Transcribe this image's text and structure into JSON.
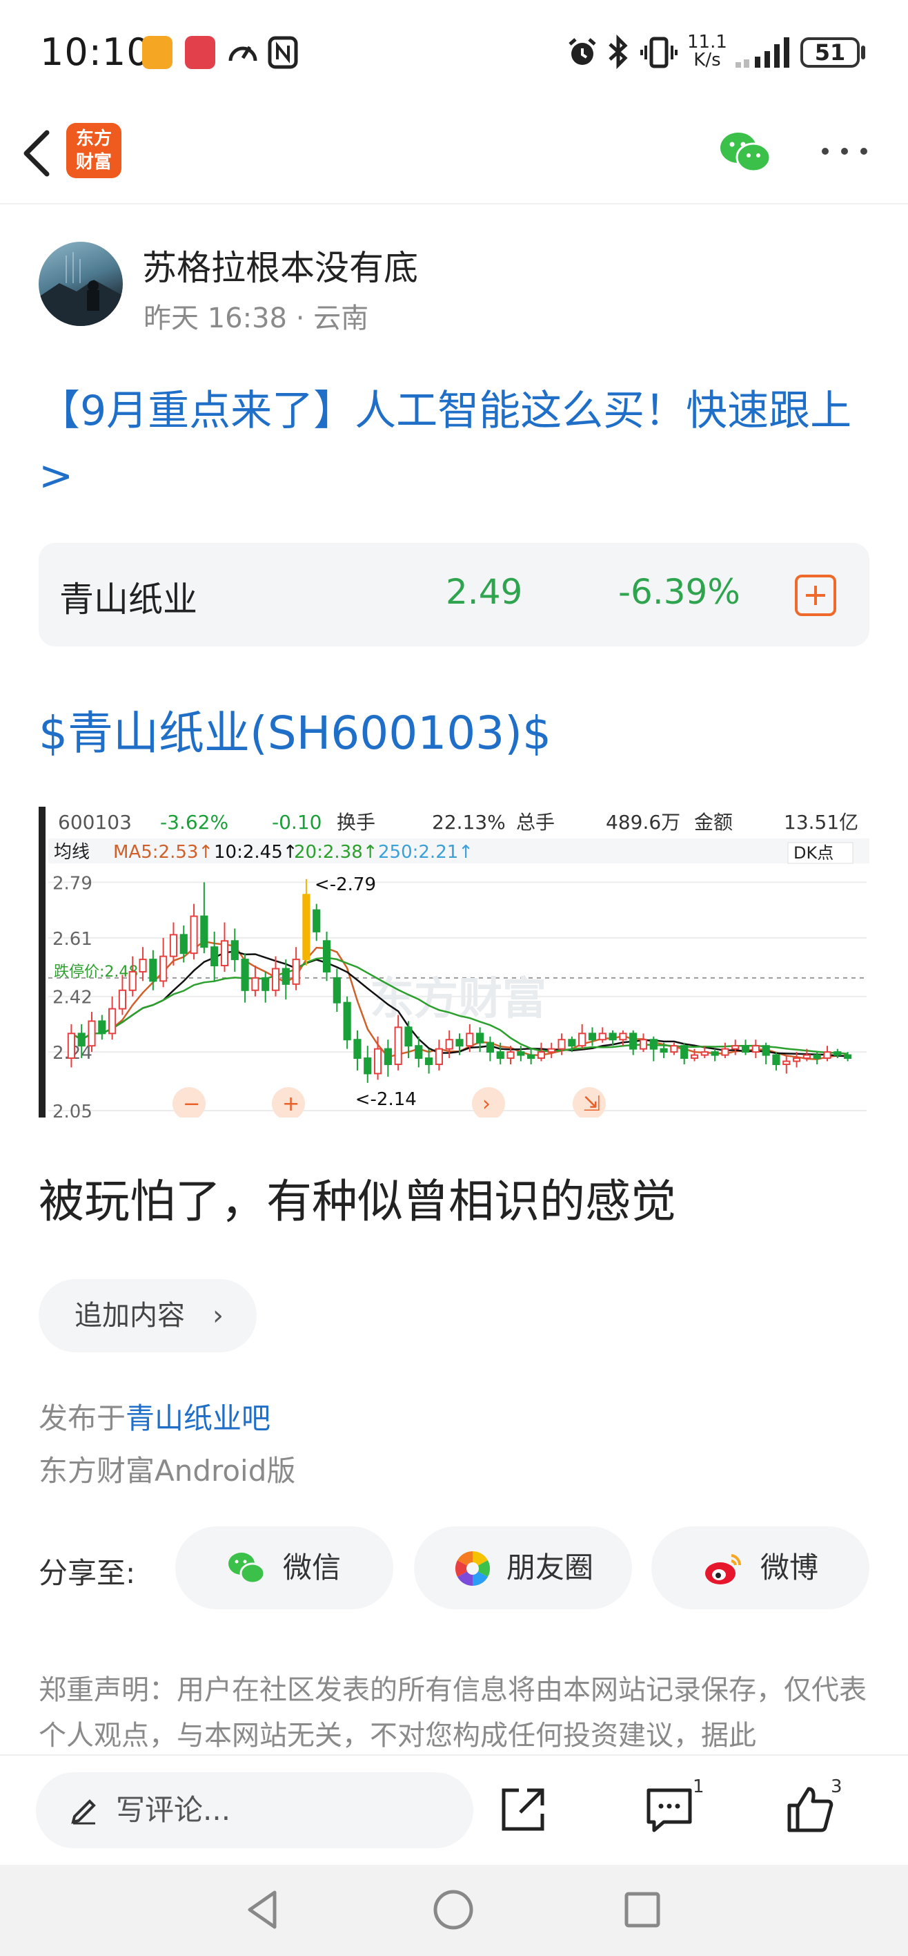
{
  "status_bar": {
    "time": "10:10",
    "net_speed_value": "11.1",
    "net_speed_unit": "K/s",
    "battery": "51"
  },
  "nav": {
    "logo_text_line1": "东方",
    "logo_text_line2": "财富"
  },
  "post": {
    "author": "苏格拉根本没有底",
    "meta": "昨天 16:38 · 云南",
    "promo_title": "【9月重点来了】人工智能这么买！快速跟上>",
    "stock_tag": "$青山纸业(SH600103)$",
    "text": "被玩怕了，有种似曾相识的感觉",
    "append_label": "追加内容",
    "posted_in_prefix": "发布于",
    "posted_in_bar": "青山纸业吧",
    "client": "东方财富Android版"
  },
  "stock_card": {
    "name": "青山纸业",
    "price": "2.49",
    "change": "-6.39%"
  },
  "share": {
    "label": "分享至:",
    "wechat": "微信",
    "moments": "朋友圈",
    "weibo": "微博"
  },
  "disclaimer": "郑重声明：用户在社区发表的所有信息将由本网站记录保存，仅代表个人观点，与本网站无关，不对您构成任何投资建议，据此",
  "action_bar": {
    "comment_placeholder": "写评论...",
    "comment_count": "1",
    "like_count": "3"
  },
  "chart_data": {
    "type": "candlestick",
    "code": "600103",
    "header": {
      "pct": "-3.62%",
      "chg": "-0.10",
      "turnover_label": "换手",
      "turnover": "22.13%",
      "volume_label": "总手",
      "volume": "489.6万",
      "amount_label": "金额",
      "amount": "13.51亿"
    },
    "ma_line": {
      "label": "均线",
      "ma5": "MA5:2.53↑",
      "ma10": "10:2.45↑",
      "ma20": "20:2.38↑",
      "ma250": "250:2.21↑",
      "dk": "DK点"
    },
    "y_ticks": [
      "2.79",
      "2.61",
      "2.42",
      "2.24",
      "2.05"
    ],
    "ylim": [
      2.05,
      2.82
    ],
    "limit_down_label": "跌停价:2.48",
    "high_annotation": "<-2.79",
    "low_annotation": "<-2.14",
    "watermark": "东方财富",
    "candles": [
      {
        "o": 2.22,
        "c": 2.3,
        "h": 2.33,
        "l": 2.19
      },
      {
        "o": 2.3,
        "c": 2.26,
        "h": 2.33,
        "l": 2.22
      },
      {
        "o": 2.26,
        "c": 2.34,
        "h": 2.37,
        "l": 2.24
      },
      {
        "o": 2.34,
        "c": 2.3,
        "h": 2.36,
        "l": 2.28
      },
      {
        "o": 2.3,
        "c": 2.38,
        "h": 2.42,
        "l": 2.28
      },
      {
        "o": 2.38,
        "c": 2.44,
        "h": 2.49,
        "l": 2.36
      },
      {
        "o": 2.44,
        "c": 2.5,
        "h": 2.55,
        "l": 2.42
      },
      {
        "o": 2.5,
        "c": 2.54,
        "h": 2.58,
        "l": 2.47
      },
      {
        "o": 2.54,
        "c": 2.47,
        "h": 2.57,
        "l": 2.44
      },
      {
        "o": 2.47,
        "c": 2.55,
        "h": 2.61,
        "l": 2.45
      },
      {
        "o": 2.55,
        "c": 2.62,
        "h": 2.66,
        "l": 2.52
      },
      {
        "o": 2.62,
        "c": 2.56,
        "h": 2.65,
        "l": 2.53
      },
      {
        "o": 2.56,
        "c": 2.68,
        "h": 2.72,
        "l": 2.54
      },
      {
        "o": 2.68,
        "c": 2.58,
        "h": 2.79,
        "l": 2.56
      },
      {
        "o": 2.58,
        "c": 2.52,
        "h": 2.63,
        "l": 2.47
      },
      {
        "o": 2.52,
        "c": 2.6,
        "h": 2.66,
        "l": 2.5
      },
      {
        "o": 2.6,
        "c": 2.54,
        "h": 2.64,
        "l": 2.5
      },
      {
        "o": 2.54,
        "c": 2.44,
        "h": 2.56,
        "l": 2.4
      },
      {
        "o": 2.44,
        "c": 2.48,
        "h": 2.52,
        "l": 2.42
      },
      {
        "o": 2.48,
        "c": 2.44,
        "h": 2.5,
        "l": 2.4
      },
      {
        "o": 2.44,
        "c": 2.51,
        "h": 2.55,
        "l": 2.42
      },
      {
        "o": 2.51,
        "c": 2.46,
        "h": 2.54,
        "l": 2.41
      },
      {
        "o": 2.46,
        "c": 2.54,
        "h": 2.58,
        "l": 2.44
      },
      {
        "o": 2.54,
        "c": 2.75,
        "h": 2.8,
        "l": 2.52
      },
      {
        "o": 2.7,
        "c": 2.63,
        "h": 2.72,
        "l": 2.6
      },
      {
        "o": 2.6,
        "c": 2.5,
        "h": 2.63,
        "l": 2.47
      },
      {
        "o": 2.48,
        "c": 2.4,
        "h": 2.51,
        "l": 2.37
      },
      {
        "o": 2.4,
        "c": 2.28,
        "h": 2.42,
        "l": 2.25
      },
      {
        "o": 2.28,
        "c": 2.22,
        "h": 2.31,
        "l": 2.18
      },
      {
        "o": 2.22,
        "c": 2.17,
        "h": 2.26,
        "l": 2.14
      },
      {
        "o": 2.17,
        "c": 2.25,
        "h": 2.29,
        "l": 2.15
      },
      {
        "o": 2.25,
        "c": 2.2,
        "h": 2.28,
        "l": 2.16
      },
      {
        "o": 2.2,
        "c": 2.32,
        "h": 2.36,
        "l": 2.18
      },
      {
        "o": 2.32,
        "c": 2.26,
        "h": 2.34,
        "l": 2.22
      },
      {
        "o": 2.26,
        "c": 2.22,
        "h": 2.29,
        "l": 2.19
      },
      {
        "o": 2.22,
        "c": 2.2,
        "h": 2.25,
        "l": 2.17
      },
      {
        "o": 2.2,
        "c": 2.25,
        "h": 2.28,
        "l": 2.18
      },
      {
        "o": 2.25,
        "c": 2.28,
        "h": 2.31,
        "l": 2.22
      },
      {
        "o": 2.28,
        "c": 2.26,
        "h": 2.3,
        "l": 2.23
      },
      {
        "o": 2.26,
        "c": 2.3,
        "h": 2.33,
        "l": 2.24
      },
      {
        "o": 2.3,
        "c": 2.27,
        "h": 2.32,
        "l": 2.24
      },
      {
        "o": 2.27,
        "c": 2.24,
        "h": 2.29,
        "l": 2.21
      },
      {
        "o": 2.24,
        "c": 2.22,
        "h": 2.27,
        "l": 2.2
      },
      {
        "o": 2.22,
        "c": 2.24,
        "h": 2.26,
        "l": 2.2
      },
      {
        "o": 2.24,
        "c": 2.23,
        "h": 2.26,
        "l": 2.21
      },
      {
        "o": 2.23,
        "c": 2.22,
        "h": 2.25,
        "l": 2.2
      },
      {
        "o": 2.22,
        "c": 2.24,
        "h": 2.27,
        "l": 2.21
      },
      {
        "o": 2.24,
        "c": 2.25,
        "h": 2.27,
        "l": 2.22
      },
      {
        "o": 2.25,
        "c": 2.28,
        "h": 2.3,
        "l": 2.23
      },
      {
        "o": 2.28,
        "c": 2.26,
        "h": 2.29,
        "l": 2.24
      },
      {
        "o": 2.26,
        "c": 2.3,
        "h": 2.33,
        "l": 2.25
      },
      {
        "o": 2.3,
        "c": 2.28,
        "h": 2.32,
        "l": 2.26
      },
      {
        "o": 2.28,
        "c": 2.3,
        "h": 2.32,
        "l": 2.27
      },
      {
        "o": 2.3,
        "c": 2.28,
        "h": 2.31,
        "l": 2.26
      },
      {
        "o": 2.28,
        "c": 2.3,
        "h": 2.31,
        "l": 2.26
      },
      {
        "o": 2.3,
        "c": 2.25,
        "h": 2.31,
        "l": 2.23
      },
      {
        "o": 2.25,
        "c": 2.28,
        "h": 2.3,
        "l": 2.24
      },
      {
        "o": 2.28,
        "c": 2.25,
        "h": 2.29,
        "l": 2.21
      },
      {
        "o": 2.25,
        "c": 2.24,
        "h": 2.27,
        "l": 2.22
      },
      {
        "o": 2.24,
        "c": 2.26,
        "h": 2.27,
        "l": 2.23
      },
      {
        "o": 2.26,
        "c": 2.22,
        "h": 2.27,
        "l": 2.2
      },
      {
        "o": 2.22,
        "c": 2.23,
        "h": 2.25,
        "l": 2.21
      },
      {
        "o": 2.23,
        "c": 2.24,
        "h": 2.26,
        "l": 2.22
      },
      {
        "o": 2.24,
        "c": 2.23,
        "h": 2.25,
        "l": 2.21
      },
      {
        "o": 2.23,
        "c": 2.25,
        "h": 2.27,
        "l": 2.22
      },
      {
        "o": 2.25,
        "c": 2.26,
        "h": 2.28,
        "l": 2.23
      },
      {
        "o": 2.26,
        "c": 2.24,
        "h": 2.28,
        "l": 2.23
      },
      {
        "o": 2.24,
        "c": 2.26,
        "h": 2.28,
        "l": 2.22
      },
      {
        "o": 2.26,
        "c": 2.23,
        "h": 2.27,
        "l": 2.2
      },
      {
        "o": 2.23,
        "c": 2.2,
        "h": 2.24,
        "l": 2.18
      },
      {
        "o": 2.2,
        "c": 2.21,
        "h": 2.23,
        "l": 2.17
      },
      {
        "o": 2.21,
        "c": 2.22,
        "h": 2.24,
        "l": 2.19
      },
      {
        "o": 2.22,
        "c": 2.23,
        "h": 2.25,
        "l": 2.21
      },
      {
        "o": 2.23,
        "c": 2.22,
        "h": 2.24,
        "l": 2.2
      },
      {
        "o": 2.22,
        "c": 2.24,
        "h": 2.26,
        "l": 2.21
      },
      {
        "o": 2.24,
        "c": 2.23,
        "h": 2.25,
        "l": 2.22
      },
      {
        "o": 2.23,
        "c": 2.22,
        "h": 2.24,
        "l": 2.21
      }
    ],
    "colors": {
      "up": "#e84040",
      "down": "#1aa038",
      "ma5": "#d0602a",
      "ma10": "#111111",
      "ma20": "#2ca02c",
      "ma250": "#3aa0d8",
      "limit_up": "#f5b400"
    }
  }
}
